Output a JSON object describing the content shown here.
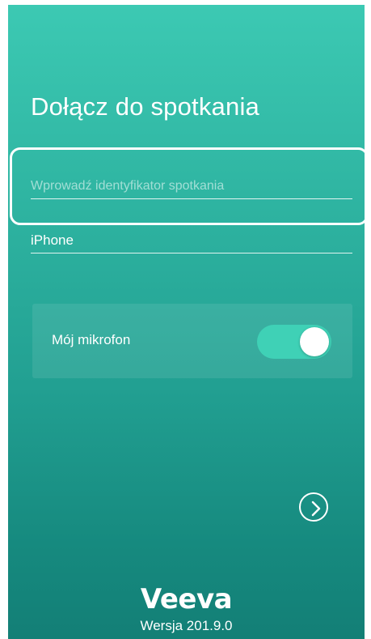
{
  "join": {
    "title": "Dołącz do spotkania",
    "meeting_id_placeholder": "Wprowadź identyfikator spotkania",
    "meeting_id_value": "",
    "name_value": "iPhone"
  },
  "microphone": {
    "label": "Mój mikrofon",
    "enabled": true
  },
  "next_button": {
    "icon": "chevron-right-icon"
  },
  "footer": {
    "logo": "Veeva",
    "version": "Wersja 201.9.0"
  },
  "colors": {
    "gradient_top": "#3cc9b3",
    "gradient_bottom": "#137f76",
    "toggle_on": "#3fd1b6",
    "text": "#ffffff"
  }
}
